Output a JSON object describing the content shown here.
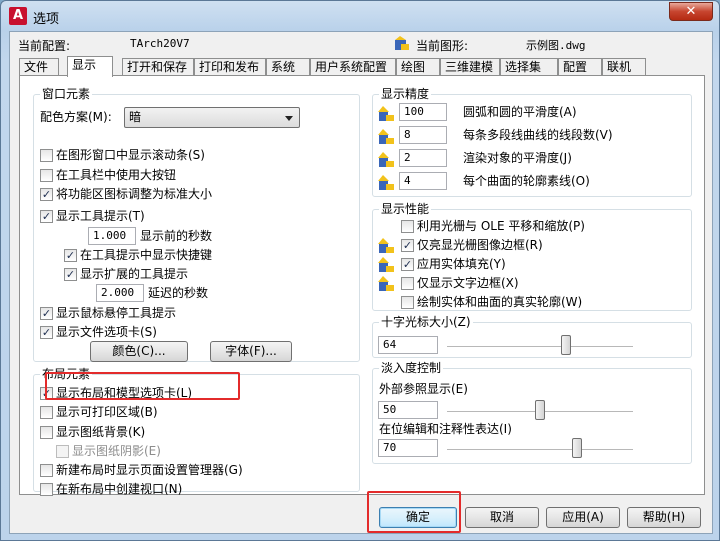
{
  "window": {
    "title": "选项",
    "app_icon_letter": "A",
    "close_glyph": "✕"
  },
  "header": {
    "current_config_label": "当前配置:",
    "current_config_value": "TArch20V7",
    "current_drawing_label": "当前图形:",
    "current_drawing_value": "示例图.dwg"
  },
  "tabs": [
    {
      "label": "文件",
      "active": false
    },
    {
      "label": "显示",
      "active": true
    },
    {
      "label": "打开和保存",
      "active": false
    },
    {
      "label": "打印和发布",
      "active": false
    },
    {
      "label": "系统",
      "active": false
    },
    {
      "label": "用户系统配置",
      "active": false
    },
    {
      "label": "绘图",
      "active": false
    },
    {
      "label": "三维建模",
      "active": false
    },
    {
      "label": "选择集",
      "active": false
    },
    {
      "label": "配置",
      "active": false
    },
    {
      "label": "联机",
      "active": false
    }
  ],
  "window_elements": {
    "title": "窗口元素",
    "color_scheme_label": "配色方案(M):",
    "color_scheme_value": "暗",
    "cb_scrollbars": {
      "label": "在图形窗口中显示滚动条(S)",
      "checked": false
    },
    "cb_large_buttons": {
      "label": "在工具栏中使用大按钮",
      "checked": false
    },
    "cb_resize_ribbon": {
      "label": "将功能区图标调整为标准大小",
      "checked": true
    },
    "cb_tooltips": {
      "label": "显示工具提示(T)",
      "checked": true
    },
    "tooltip_delay_value": "1.000",
    "tooltip_delay_label": "显示前的秒数",
    "cb_shortcut_keys": {
      "label": "在工具提示中显示快捷键",
      "checked": true
    },
    "cb_extended_tooltips": {
      "label": "显示扩展的工具提示",
      "checked": true
    },
    "extended_delay_value": "2.000",
    "extended_delay_label": "延迟的秒数",
    "cb_rollover": {
      "label": "显示鼠标悬停工具提示",
      "checked": true
    },
    "cb_file_tabs": {
      "label": "显示文件选项卡(S)",
      "checked": true
    },
    "colors_button": "颜色(C)...",
    "fonts_button": "字体(F)..."
  },
  "layout_elements": {
    "title": "布局元素",
    "cb_layout_model_tabs": {
      "label": "显示布局和模型选项卡(L)",
      "checked": true
    },
    "cb_printable_area": {
      "label": "显示可打印区域(B)",
      "checked": false
    },
    "cb_paper_background": {
      "label": "显示图纸背景(K)",
      "checked": false
    },
    "cb_paper_shadow": {
      "label": "显示图纸阴影(E)",
      "checked": false
    },
    "cb_page_setup_manager": {
      "label": "新建布局时显示页面设置管理器(G)",
      "checked": false
    },
    "cb_create_viewport": {
      "label": "在新布局中创建视口(N)",
      "checked": false
    }
  },
  "display_resolution": {
    "title": "显示精度",
    "items": [
      {
        "value": "100",
        "label": "圆弧和圆的平滑度(A)"
      },
      {
        "value": "8",
        "label": "每条多段线曲线的线段数(V)"
      },
      {
        "value": "2",
        "label": "渲染对象的平滑度(J)"
      },
      {
        "value": "4",
        "label": "每个曲面的轮廓素线(O)"
      }
    ]
  },
  "display_performance": {
    "title": "显示性能",
    "items": [
      {
        "label": "利用光栅与 OLE 平移和缩放(P)",
        "checked": false,
        "icon": false
      },
      {
        "label": "仅亮显光栅图像边框(R)",
        "checked": true,
        "icon": true
      },
      {
        "label": "应用实体填充(Y)",
        "checked": true,
        "icon": true
      },
      {
        "label": "仅显示文字边框(X)",
        "checked": false,
        "icon": true
      },
      {
        "label": "绘制实体和曲面的真实轮廓(W)",
        "checked": false,
        "icon": false
      }
    ]
  },
  "crosshair": {
    "title": "十字光标大小(Z)",
    "value": "64",
    "level": 0.64
  },
  "fade_control": {
    "title": "淡入度控制",
    "xref_label": "外部参照显示(E)",
    "xref_value": "50",
    "xref_level": 0.5,
    "inplace_label": "在位编辑和注释性表达(I)",
    "inplace_value": "70",
    "inplace_level": 0.7
  },
  "footer": {
    "ok": "确定",
    "cancel": "取消",
    "apply": "应用(A)",
    "help": "帮助(H)"
  },
  "colors": {
    "highlight": "#e32b2b",
    "check": "#1c2c4f"
  }
}
